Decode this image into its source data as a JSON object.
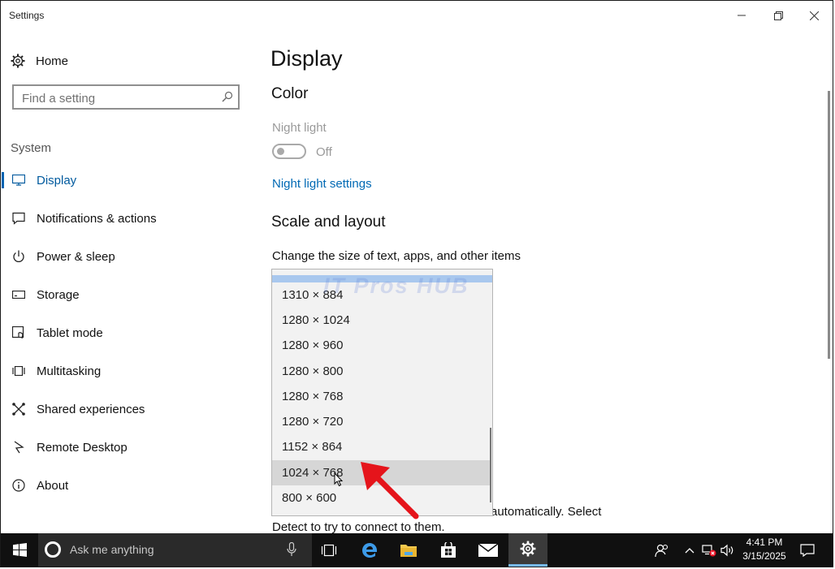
{
  "window": {
    "title": "Settings",
    "minimize_glyph": "—",
    "restore_glyph": "❐",
    "close_glyph": "✕"
  },
  "sidebar": {
    "home_label": "Home",
    "search_placeholder": "Find a setting",
    "section_label": "System",
    "items": [
      {
        "label": "Display",
        "icon": "monitor-icon",
        "selected": true
      },
      {
        "label": "Notifications & actions",
        "icon": "notification-icon"
      },
      {
        "label": "Power & sleep",
        "icon": "power-icon"
      },
      {
        "label": "Storage",
        "icon": "storage-icon"
      },
      {
        "label": "Tablet mode",
        "icon": "tablet-mode-icon"
      },
      {
        "label": "Multitasking",
        "icon": "multitasking-icon"
      },
      {
        "label": "Shared experiences",
        "icon": "shared-experiences-icon"
      },
      {
        "label": "Remote Desktop",
        "icon": "remote-desktop-icon"
      },
      {
        "label": "About",
        "icon": "info-icon"
      }
    ]
  },
  "main": {
    "page_title": "Display",
    "color_heading": "Color",
    "night_light_label": "Night light",
    "night_light_state": "Off",
    "night_light_link": "Night light settings",
    "scale_heading": "Scale and layout",
    "scale_desc": "Change the size of text, apps, and other items",
    "hidden_text_line1": "automatically. Select",
    "hidden_text_line2": "Detect to try to connect to them."
  },
  "resolution_dropdown": {
    "options": [
      "1310 × 884",
      "1280 × 1024",
      "1280 × 960",
      "1280 × 800",
      "1280 × 768",
      "1280 × 720",
      "1152 × 864",
      "1024 × 768",
      "800 × 600"
    ],
    "hovered": "1024 × 768"
  },
  "watermark": "IT Pros HUB",
  "taskbar": {
    "search_placeholder": "Ask me anything",
    "time": "4:41 PM",
    "date": "3/15/2025"
  },
  "colors": {
    "accent": "#0063b1",
    "link": "#0069b4",
    "taskbar": "#101010",
    "arrow": "#e5141b"
  }
}
